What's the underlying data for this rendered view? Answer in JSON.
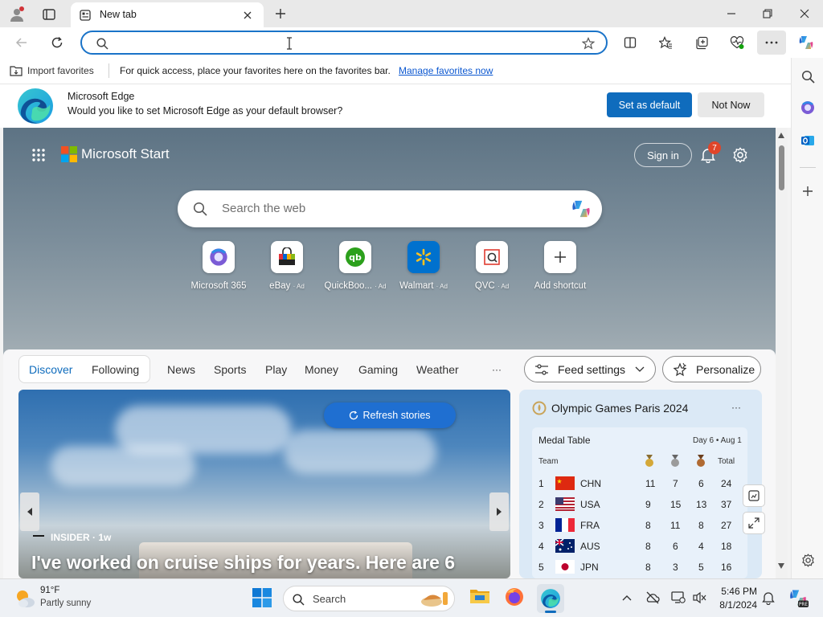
{
  "browser": {
    "tab_title": "New tab",
    "address_value": "",
    "import_favorites": "Import favorites",
    "favbar_message": "For quick access, place your favorites here on the favorites bar.",
    "manage_favorites": "Manage favorites now"
  },
  "infobar": {
    "title": "Microsoft Edge",
    "message": "Would you like to set Microsoft Edge as your default browser?",
    "set_default": "Set as default",
    "not_now": "Not Now"
  },
  "start": {
    "brand": "Microsoft Start",
    "sign_in": "Sign in",
    "notification_count": "7",
    "search_placeholder": "Search the web",
    "shortcuts": [
      {
        "label": "Microsoft 365",
        "ad": ""
      },
      {
        "label": "eBay",
        "ad": "· Ad"
      },
      {
        "label": "QuickBoo...",
        "ad": "· Ad"
      },
      {
        "label": "Walmart",
        "ad": "· Ad"
      },
      {
        "label": "QVC",
        "ad": "· Ad"
      },
      {
        "label": "Add shortcut",
        "ad": ""
      }
    ]
  },
  "feed": {
    "tabs": [
      "Discover",
      "Following"
    ],
    "nav": [
      "News",
      "Sports",
      "Play",
      "Money",
      "Gaming",
      "Weather"
    ],
    "more": "···",
    "feed_settings": "Feed settings",
    "personalize": "Personalize",
    "refresh": "Refresh stories",
    "story_source": "INSIDER · 1w",
    "story_title": "I've worked on cruise ships for years. Here are 6"
  },
  "olympics": {
    "title": "Olympic Games Paris 2024",
    "more": "···",
    "medal_table": "Medal Table",
    "day": "Day 6 • Aug 1",
    "team_header": "Team",
    "total_header": "Total",
    "rows": [
      {
        "rank": "1",
        "team": "CHN",
        "gold": "11",
        "silver": "7",
        "bronze": "6",
        "total": "24"
      },
      {
        "rank": "2",
        "team": "USA",
        "gold": "9",
        "silver": "15",
        "bronze": "13",
        "total": "37"
      },
      {
        "rank": "3",
        "team": "FRA",
        "gold": "8",
        "silver": "11",
        "bronze": "8",
        "total": "27"
      },
      {
        "rank": "4",
        "team": "AUS",
        "gold": "8",
        "silver": "6",
        "bronze": "4",
        "total": "18"
      },
      {
        "rank": "5",
        "team": "JPN",
        "gold": "8",
        "silver": "3",
        "bronze": "5",
        "total": "16"
      }
    ]
  },
  "taskbar": {
    "temp": "91°F",
    "condition": "Partly sunny",
    "search": "Search",
    "time": "5:46 PM",
    "date": "8/1/2024"
  },
  "colors": {
    "accent": "#0f6cbd",
    "link": "#0b57d0",
    "badge": "#e0452a"
  }
}
